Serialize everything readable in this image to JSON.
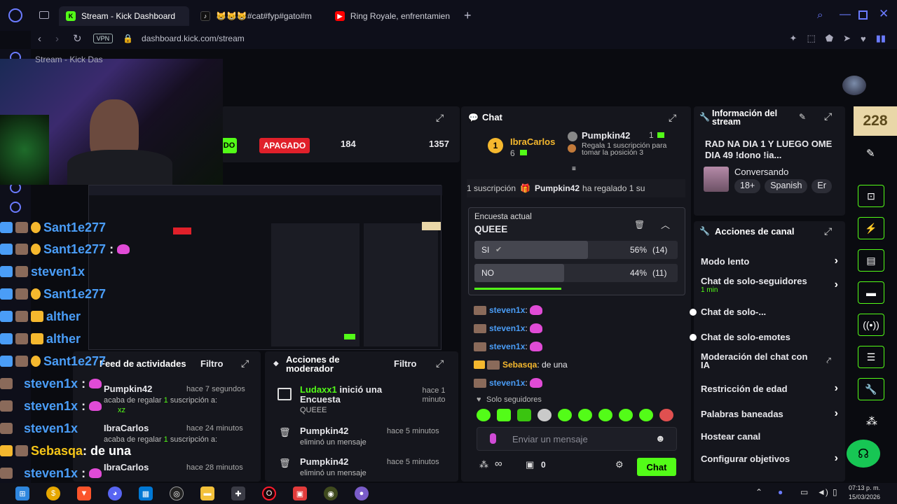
{
  "browser": {
    "tabs": [
      {
        "label": "Stream - Kick Dashboard"
      },
      {
        "label": "😸😸😸#cat#fyp#gato#m"
      },
      {
        "label": "Ring Royale, enfrentamien"
      }
    ],
    "new_tab": "+",
    "vpn": "VPN",
    "url": "dashboard.kick.com/stream"
  },
  "overlay_tab_label": "Stream - Kick Das",
  "stats": {
    "status": "APAGADO",
    "followers": "184",
    "views": "1357",
    "truncated": "DO"
  },
  "live_counter": "228",
  "chat": {
    "title": "Chat",
    "top_gifter": {
      "name": "IbraCarlos",
      "count": "6",
      "rank": "1"
    },
    "gifter2": {
      "name": "Pumpkin42",
      "count": "1",
      "text": "Regala 1 suscripción para tomar la posición 3"
    },
    "gift_banner": {
      "count": "1 suscripción",
      "name": "Pumpkin42",
      "rest": "ha regalado 1 su"
    },
    "poll": {
      "label": "Encuesta actual",
      "question": "QUEEE",
      "options": [
        {
          "label": "SI",
          "pct": "56%",
          "count": "(14)",
          "fraction": 0.56
        },
        {
          "label": "NO",
          "pct": "44%",
          "count": "(11)",
          "fraction": 0.44
        }
      ]
    },
    "messages": [
      {
        "user": "steven1x",
        "text": ""
      },
      {
        "user": "steven1x",
        "text": ""
      },
      {
        "user": "steven1x",
        "text": ""
      },
      {
        "user": "Sebasqa",
        "text": "de una"
      },
      {
        "user": "steven1x",
        "text": ""
      }
    ],
    "mode_label": "Solo seguidores",
    "input_placeholder": "Enviar un mensaje",
    "points": "0",
    "send_label": "Chat"
  },
  "stream_info": {
    "title": "Información del stream",
    "stream_title": "RAD NA DIA 1 Y LUEGO OME DIA 49 !dono !ia...",
    "category": "Conversando",
    "tags": [
      "18+",
      "Spanish",
      "Er"
    ]
  },
  "channel_actions": {
    "title": "Acciones de canal",
    "items": [
      {
        "label": "Modo lento",
        "sub": "",
        "control": "chevron"
      },
      {
        "label": "Chat de solo-seguidores",
        "sub": "1 min",
        "control": "chevron"
      },
      {
        "label": "Chat de solo-...",
        "sub": "",
        "control": "toggle"
      },
      {
        "label": "Chat de solo-emotes",
        "sub": "",
        "control": "toggle"
      },
      {
        "label": "Moderación del chat con IA",
        "sub": "",
        "control": "external"
      },
      {
        "label": "Restricción de edad",
        "sub": "",
        "control": "chevron"
      },
      {
        "label": "Palabras baneadas",
        "sub": "",
        "control": "chevron"
      },
      {
        "label": "Hostear canal",
        "sub": "",
        "control": "none"
      },
      {
        "label": "Configurar objetivos",
        "sub": "",
        "control": "chevron"
      }
    ]
  },
  "activity": {
    "title": "Feed de actividades",
    "visible_title": "Feed de actividades",
    "filter": "Filtro",
    "items": [
      {
        "user": "Pumpkin42",
        "time": "hace 7 segundos",
        "line": "acaba de regalar",
        "amount": "1",
        "rest": "suscripción a:",
        "target": "xz"
      },
      {
        "user": "IbraCarlos",
        "time": "hace 24 minutos",
        "line": "acaba de regalar",
        "amount": "1",
        "rest": "suscripción a:",
        "target": ""
      },
      {
        "user": "IbraCarlos",
        "time": "hace 28 minutos",
        "line": "",
        "amount": "",
        "rest": "",
        "target": ""
      }
    ]
  },
  "mod_actions": {
    "title": "Acciones de moderador",
    "filter": "Filtro",
    "items": [
      {
        "user": "Ludaxx1",
        "action": "inició una Encuesta",
        "detail": "QUEEE",
        "time": "hace 1 minuto"
      },
      {
        "user": "Pumpkin42",
        "action": "",
        "detail": "eliminó un mensaje",
        "time": "hace 5 minutos"
      },
      {
        "user": "Pumpkin42",
        "action": "",
        "detail": "eliminó un mensaje",
        "time": "hace 5 minutos"
      }
    ]
  },
  "overlay_chat": [
    {
      "user": "Sant1e277",
      "text": "",
      "color": "#4a9df7"
    },
    {
      "user": "Sant1e277",
      "text": "",
      "color": "#4a9df7"
    },
    {
      "user": "steven1x",
      "text": "",
      "color": "#4a9df7"
    },
    {
      "user": "Sant1e277",
      "text": "",
      "color": "#4a9df7"
    },
    {
      "user": "alther",
      "text": "",
      "color": "#4a9df7"
    },
    {
      "user": "alther",
      "text": "",
      "color": "#4a9df7"
    },
    {
      "user": "Sant1e277",
      "text": "",
      "color": "#4a9df7"
    },
    {
      "user": "steven1x",
      "text": "",
      "color": "#4a9df7"
    },
    {
      "user": "steven1x",
      "text": "",
      "color": "#4a9df7"
    },
    {
      "user": "steven1x",
      "text": "",
      "color": "#4a9df7"
    },
    {
      "user": "Sebasqa",
      "text": ": de una",
      "color": "#f5c518"
    },
    {
      "user": "steven1x",
      "text": "",
      "color": "#4a9df7"
    }
  ],
  "clock": {
    "time": "07:13 p. m.",
    "date": "15/03/2026"
  },
  "colors": {
    "accent": "#53fc18",
    "danger": "#e0202a",
    "panel": "#15161d",
    "bg": "#0a0b10"
  }
}
